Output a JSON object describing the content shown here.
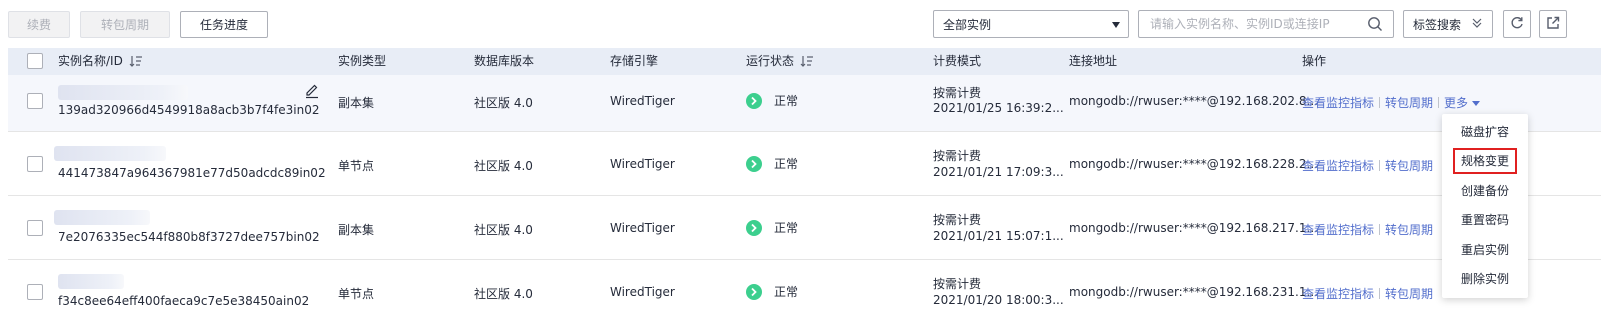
{
  "toolbar": {
    "renew": "续费",
    "to_yearly": "转包周期",
    "task_progress": "任务进度",
    "instance_filter": "全部实例",
    "search_placeholder": "请输入实例名称、实例ID或连接IP",
    "tag_search": "标签搜索"
  },
  "table": {
    "headers": [
      "实例名称/ID",
      "实例类型",
      "数据库版本",
      "存储引擎",
      "运行状态",
      "计费模式",
      "连接地址",
      "操作"
    ],
    "rows": [
      {
        "id": "139ad320966d4549918a8acb3b7f4fe3in02",
        "type": "副本集",
        "version": "社区版 4.0",
        "engine": "WiredTiger",
        "status": "正常",
        "billing": "按需计费",
        "created": "2021/01/25 16:39:2...",
        "address": "mongodb://rwuser:****@192.168.202.8..."
      },
      {
        "id": "441473847a964367981e77d50adcdc89in02",
        "type": "单节点",
        "version": "社区版 4.0",
        "engine": "WiredTiger",
        "status": "正常",
        "billing": "按需计费",
        "created": "2021/01/21 17:09:3...",
        "address": "mongodb://rwuser:****@192.168.228.2..."
      },
      {
        "id": "7e2076335ec544f880b8f3727dee757bin02",
        "type": "副本集",
        "version": "社区版 4.0",
        "engine": "WiredTiger",
        "status": "正常",
        "billing": "按需计费",
        "created": "2021/01/21 15:07:1...",
        "address": "mongodb://rwuser:****@192.168.217.1..."
      },
      {
        "id": "f34c8ee64eff400faeca9c7e5e38450ain02",
        "type": "单节点",
        "version": "社区版 4.0",
        "engine": "WiredTiger",
        "status": "正常",
        "billing": "按需计费",
        "created": "2021/01/20 18:00:3...",
        "address": "mongodb://rwuser:****@192.168.231.1..."
      }
    ],
    "actions": {
      "monitor": "查看监控指标",
      "yearly": "转包周期",
      "more": "更多"
    }
  },
  "more_menu": [
    "磁盘扩容",
    "规格变更",
    "创建备份",
    "重置密码",
    "重启实例",
    "删除实例"
  ],
  "colors": {
    "accent": "#526ecc",
    "status_ok": "#3ccf8e",
    "header_bg": "#e8edf6",
    "highlight": "#e02020"
  }
}
